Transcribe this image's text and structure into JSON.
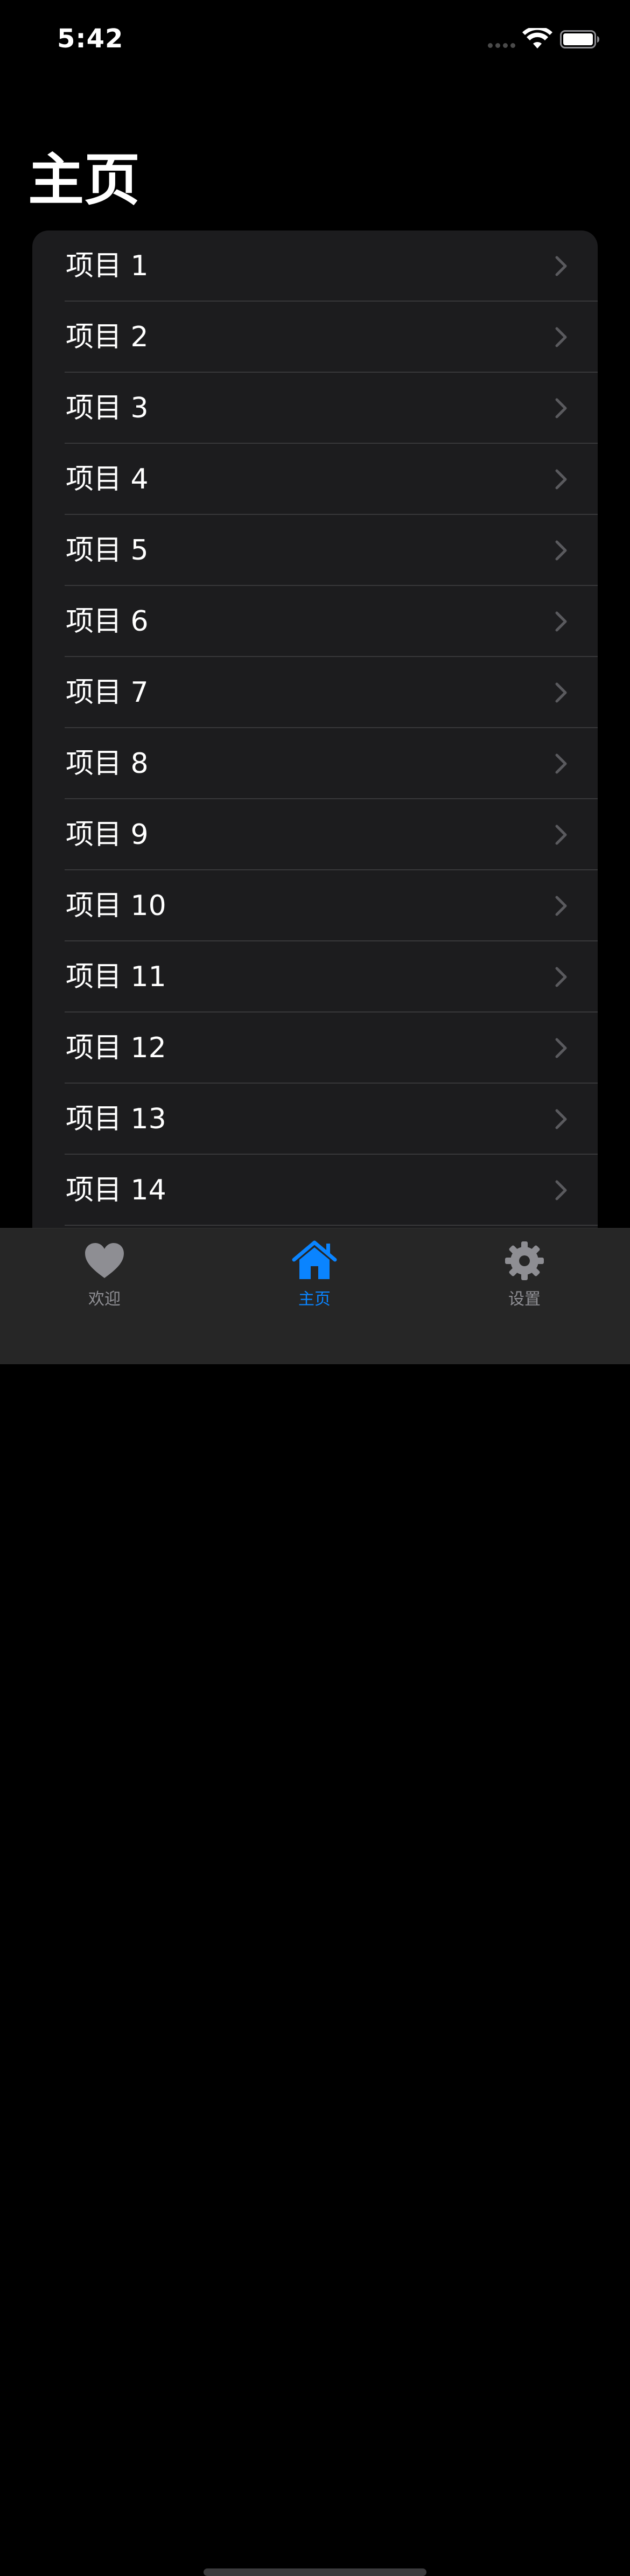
{
  "status_bar": {
    "time": "5:42"
  },
  "page": {
    "title": "主页"
  },
  "list": {
    "items": [
      {
        "label": "项目 1"
      },
      {
        "label": "项目 2"
      },
      {
        "label": "项目 3"
      },
      {
        "label": "项目 4"
      },
      {
        "label": "项目 5"
      },
      {
        "label": "项目 6"
      },
      {
        "label": "项目 7"
      },
      {
        "label": "项目 8"
      },
      {
        "label": "项目 9"
      },
      {
        "label": "项目 10"
      },
      {
        "label": "项目 11"
      },
      {
        "label": "项目 12"
      },
      {
        "label": "项目 13"
      },
      {
        "label": "项目 14"
      }
    ],
    "row_icon": "chevron-right-icon"
  },
  "tab_bar": {
    "tabs": [
      {
        "label": "欢迎",
        "icon": "heart-icon",
        "active": false
      },
      {
        "label": "主页",
        "icon": "house-icon",
        "active": true
      },
      {
        "label": "设置",
        "icon": "gear-icon",
        "active": false
      }
    ],
    "active_color": "#0a84ff",
    "inactive_color": "#8e8e93"
  },
  "colors": {
    "background": "#000000",
    "card": "#1c1c1e",
    "separator": "#38383a",
    "chevron": "#5a5a5e"
  }
}
